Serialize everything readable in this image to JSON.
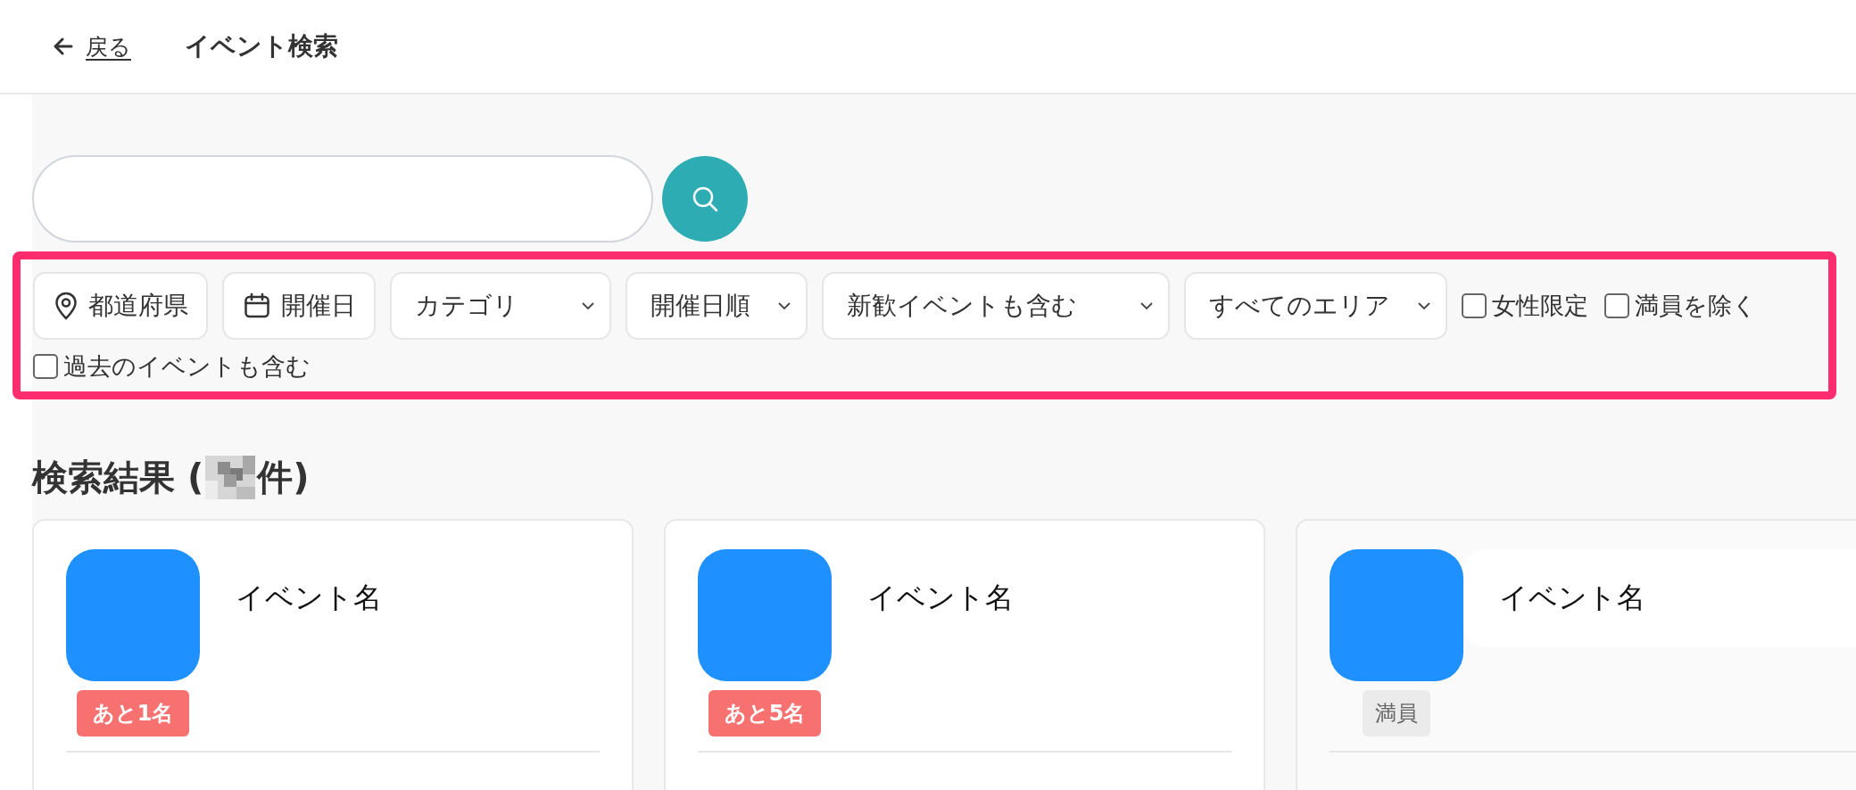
{
  "header": {
    "back_label": "戻る",
    "title": "イベント検索"
  },
  "filter_rows": [
    [
      {
        "kind": "location",
        "label": "都道府県"
      },
      {
        "kind": "date",
        "label": "開催日"
      },
      {
        "kind": "select",
        "label": "カテゴリ"
      },
      {
        "kind": "select",
        "label": "開催日順"
      },
      {
        "kind": "select",
        "label": "新歓イベントも含む"
      },
      {
        "kind": "select",
        "label": "すべてのエリア"
      },
      {
        "kind": "checkbox",
        "label": "女性限定",
        "checked": false
      },
      {
        "kind": "checkbox",
        "label": "満員を除く",
        "checked": false
      }
    ],
    [
      {
        "kind": "checkbox",
        "label": "過去のイベントも含む",
        "checked": false
      }
    ]
  ],
  "results": {
    "heading_prefix": "検索結果 (",
    "heading_suffix": "件)"
  },
  "events": [
    {
      "title": "イベント名",
      "badge": {
        "kind": "remaining",
        "text": "あと1名"
      }
    },
    {
      "title": "イベント名",
      "badge": {
        "kind": "remaining",
        "text": "あと5名"
      }
    },
    {
      "title": "イベント名",
      "badge": {
        "kind": "full",
        "text": "満員"
      }
    }
  ]
}
